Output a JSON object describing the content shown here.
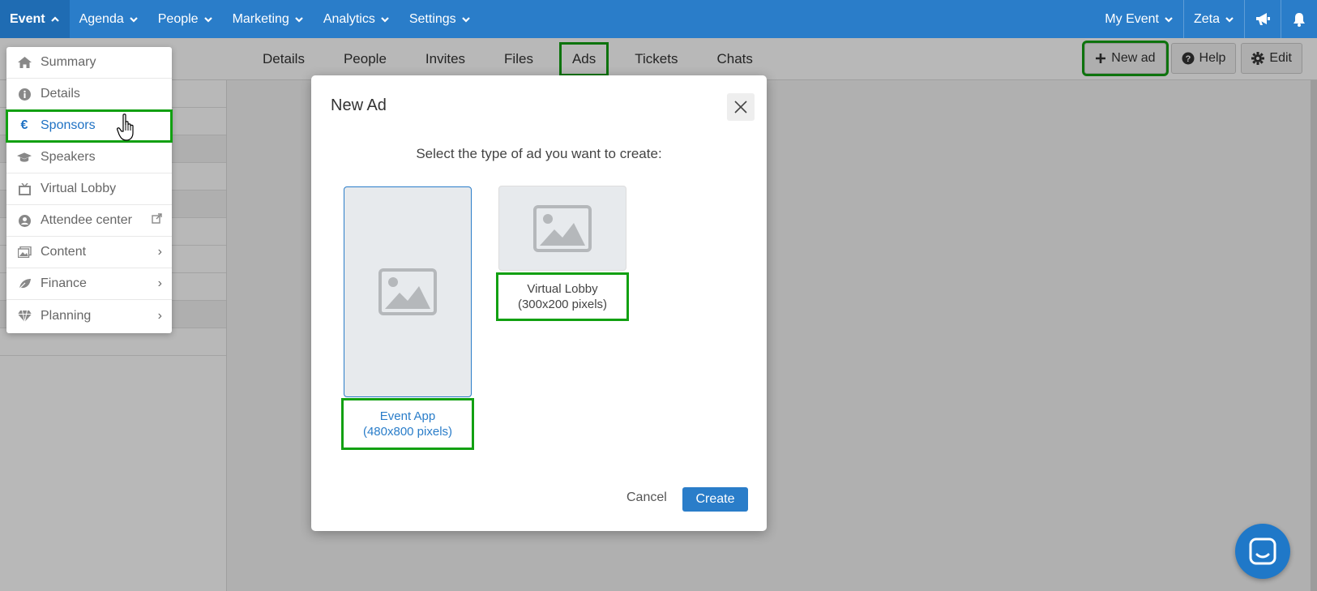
{
  "topnav": {
    "items": [
      {
        "label": "Event",
        "active": true
      },
      {
        "label": "Agenda"
      },
      {
        "label": "People"
      },
      {
        "label": "Marketing"
      },
      {
        "label": "Analytics"
      },
      {
        "label": "Settings"
      }
    ],
    "right": {
      "event_label": "My Event",
      "user_label": "Zeta"
    }
  },
  "subnav": {
    "tabs": [
      "Details",
      "People",
      "Invites",
      "Files",
      "Ads",
      "Tickets",
      "Chats"
    ],
    "active_tab": "Ads",
    "new_ad_label": "New ad",
    "help_label": "Help",
    "edit_label": "Edit"
  },
  "menu": {
    "items": [
      {
        "label": "Summary",
        "icon": "home-icon"
      },
      {
        "label": "Details",
        "icon": "info-icon"
      },
      {
        "label": "Sponsors",
        "icon": "euro-icon",
        "selected": true
      },
      {
        "label": "Speakers",
        "icon": "graduation-cap-icon"
      },
      {
        "label": "Virtual Lobby",
        "icon": "tv-icon"
      },
      {
        "label": "Attendee center",
        "icon": "user-circle-icon",
        "external": true
      },
      {
        "label": "Content",
        "icon": "images-icon",
        "submenu": true
      },
      {
        "label": "Finance",
        "icon": "leaf-icon",
        "submenu": true
      },
      {
        "label": "Planning",
        "icon": "diamond-icon",
        "submenu": true
      }
    ]
  },
  "modal": {
    "title": "New Ad",
    "prompt": "Select the type of ad you want to create:",
    "options": [
      {
        "name": "Event App",
        "size": "(480x800 pixels)",
        "selected": true
      },
      {
        "name": "Virtual Lobby",
        "size": "(300x200 pixels)",
        "selected": false
      }
    ],
    "cancel_label": "Cancel",
    "create_label": "Create"
  },
  "colors": {
    "brand": "#2a7dc9",
    "highlight": "#12a012"
  }
}
